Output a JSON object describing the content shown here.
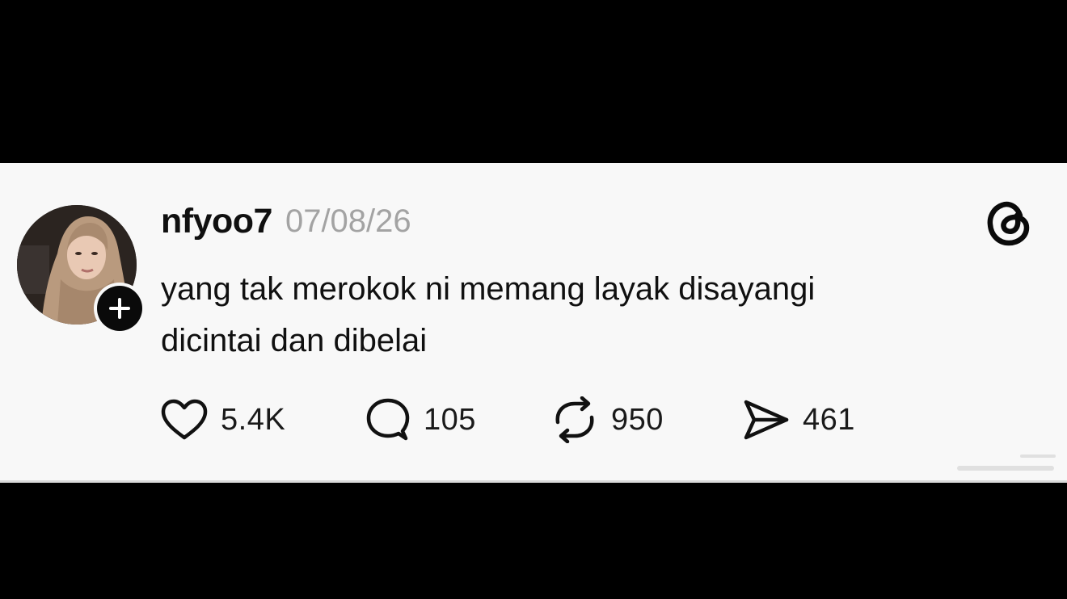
{
  "post": {
    "username": "nfyoo7",
    "timestamp": "07/08/26",
    "text_lines": [
      "yang tak merokok ni memang layak disayangi",
      "dicintai dan dibelai"
    ]
  },
  "actions": {
    "likes": "5.4K",
    "replies": "105",
    "reposts": "950",
    "shares": "461"
  },
  "icons": {
    "brand": "threads-logo-icon",
    "follow": "plus-icon",
    "like": "heart-icon",
    "reply": "speech-bubble-icon",
    "repost": "repost-arrows-icon",
    "share": "paper-plane-icon"
  },
  "colors": {
    "card_background": "#f8f8f8",
    "letterbox": "#000000",
    "text": "#101010",
    "timestamp": "#a3a3a3"
  }
}
